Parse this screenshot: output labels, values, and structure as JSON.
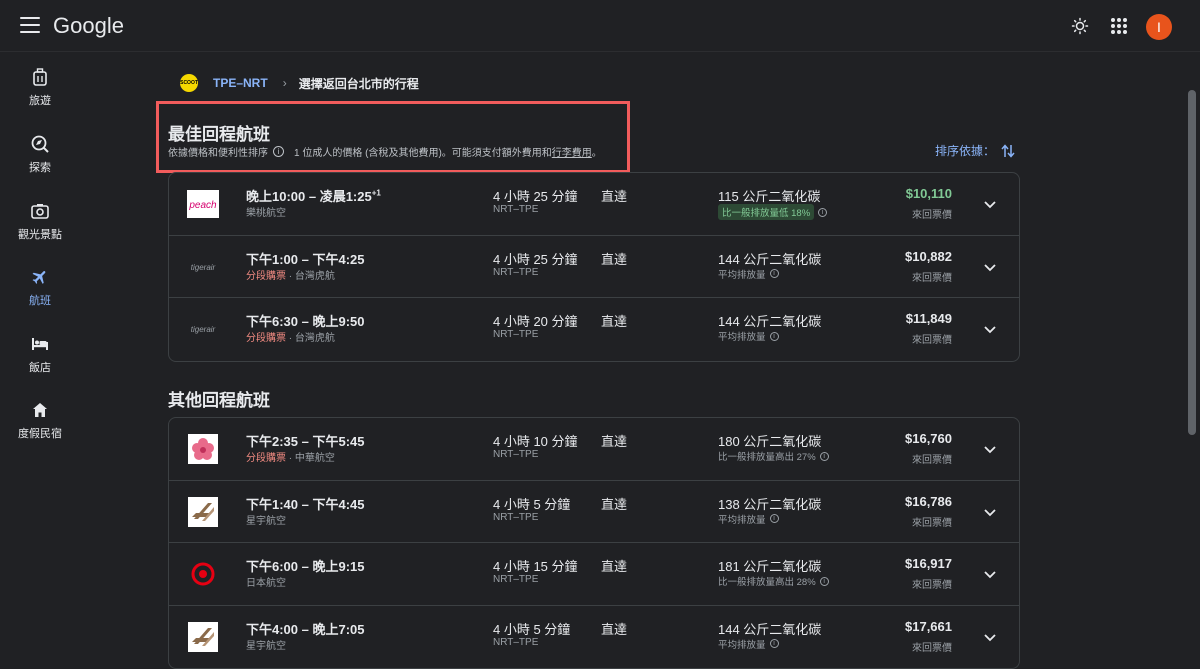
{
  "header": {
    "logo": "Google",
    "avatar_letter": "I"
  },
  "sidebar": {
    "items": [
      {
        "label": "旅遊",
        "icon": "luggage-icon"
      },
      {
        "label": "探索",
        "icon": "explore-icon"
      },
      {
        "label": "觀光景點",
        "icon": "camera-icon"
      },
      {
        "label": "航班",
        "icon": "airplane-icon",
        "active": true
      },
      {
        "label": "飯店",
        "icon": "bed-icon"
      },
      {
        "label": "度假民宿",
        "icon": "home-icon"
      }
    ]
  },
  "breadcrumb": {
    "badge": "SCOOT",
    "route": "TPE–NRT",
    "separator": "›",
    "title": "選擇返回台北市的行程"
  },
  "best": {
    "title": "最佳回程航班",
    "sort_note": "依據價格和便利性排序",
    "price_note": "1 位成人的價格 (含稅及其他費用)。可能須支付額外費用和",
    "baggage_link": "行李費用",
    "period": "。",
    "sort_label": "排序依據：",
    "flights": [
      {
        "logo": "peach",
        "times": "晚上10:00 – 凌晨1:25",
        "plus": "+1",
        "split": "",
        "airline": "樂桃航空",
        "duration": "4 小時 25 分鐘",
        "airports": "NRT–TPE",
        "stops": "直達",
        "co2": "115 公斤二氧化碳",
        "co2_note": "比一般排放量低 18%",
        "co2_good": true,
        "price": "$10,110",
        "price_good": true,
        "price_type": "來回票價"
      },
      {
        "logo": "tigerair",
        "times": "下午1:00 – 下午4:25",
        "plus": "",
        "split": "分段購票",
        "airline": " · 台灣虎航",
        "duration": "4 小時 25 分鐘",
        "airports": "NRT–TPE",
        "stops": "直達",
        "co2": "144 公斤二氧化碳",
        "co2_note": "平均排放量",
        "co2_good": false,
        "price": "$10,882",
        "price_good": false,
        "price_type": "來回票價"
      },
      {
        "logo": "tigerair",
        "times": "下午6:30 – 晚上9:50",
        "plus": "",
        "split": "分段購票",
        "airline": " · 台灣虎航",
        "duration": "4 小時 20 分鐘",
        "airports": "NRT–TPE",
        "stops": "直達",
        "co2": "144 公斤二氧化碳",
        "co2_note": "平均排放量",
        "co2_good": false,
        "price": "$11,849",
        "price_good": false,
        "price_type": "來回票價"
      }
    ]
  },
  "other": {
    "title": "其他回程航班",
    "flights": [
      {
        "logo": "china-airlines",
        "times": "下午2:35 – 下午5:45",
        "plus": "",
        "split": "分段購票",
        "airline": " · 中華航空",
        "duration": "4 小時 10 分鐘",
        "airports": "NRT–TPE",
        "stops": "直達",
        "co2": "180 公斤二氧化碳",
        "co2_note": "比一般排放量高出 27%",
        "co2_good": false,
        "price": "$16,760",
        "price_good": false,
        "price_type": "來回票價"
      },
      {
        "logo": "starlux",
        "times": "下午1:40 – 下午4:45",
        "plus": "",
        "split": "",
        "airline": "星宇航空",
        "duration": "4 小時 5 分鐘",
        "airports": "NRT–TPE",
        "stops": "直達",
        "co2": "138 公斤二氧化碳",
        "co2_note": "平均排放量",
        "co2_good": false,
        "price": "$16,786",
        "price_good": false,
        "price_type": "來回票價"
      },
      {
        "logo": "jal",
        "times": "下午6:00 – 晚上9:15",
        "plus": "",
        "split": "",
        "airline": "日本航空",
        "duration": "4 小時 15 分鐘",
        "airports": "NRT–TPE",
        "stops": "直達",
        "co2": "181 公斤二氧化碳",
        "co2_note": "比一般排放量高出 28%",
        "co2_good": false,
        "price": "$16,917",
        "price_good": false,
        "price_type": "來回票價"
      },
      {
        "logo": "starlux",
        "times": "下午4:00 – 晚上7:05",
        "plus": "",
        "split": "",
        "airline": "星宇航空",
        "duration": "4 小時 5 分鐘",
        "airports": "NRT–TPE",
        "stops": "直達",
        "co2": "144 公斤二氧化碳",
        "co2_note": "平均排放量",
        "co2_good": false,
        "price": "$17,661",
        "price_good": false,
        "price_type": "來回票價"
      }
    ]
  },
  "colors": {
    "accent": "#8ab4f8",
    "good": "#81c995",
    "highlight": "#f25c5c",
    "split": "#f28b82"
  }
}
